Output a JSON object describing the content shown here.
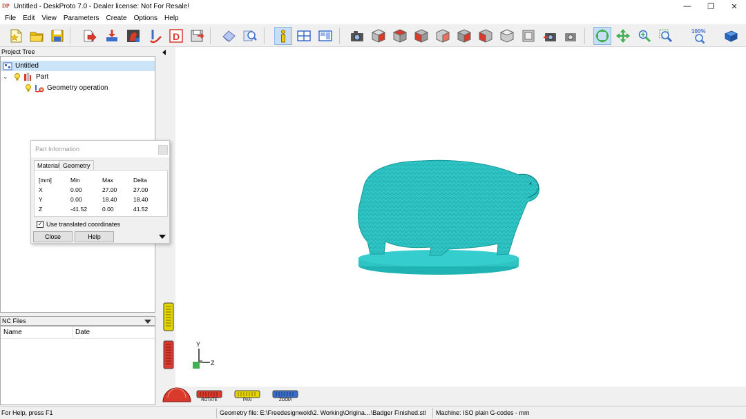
{
  "window": {
    "logo_text": "DP",
    "title": "Untitled - DeskProto 7.0 - Dealer license: Not For Resale!",
    "minimize": "—",
    "restore": "❐",
    "close": "✕"
  },
  "menu": [
    "File",
    "Edit",
    "View",
    "Parameters",
    "Create",
    "Options",
    "Help"
  ],
  "toolbar": {
    "zoom_100_label": "100%"
  },
  "project_tree": {
    "header": "Project Tree",
    "root": "Untitled",
    "part": "Part",
    "operation": "Geometry operation"
  },
  "nc_files": {
    "header": "NC Files",
    "columns": [
      "Name",
      "Date"
    ]
  },
  "part_information": {
    "title": "Part Information",
    "tabs": [
      "Material",
      "Geometry"
    ],
    "headers": [
      "[mm]",
      "Min",
      "Max",
      "Delta"
    ],
    "rows": [
      [
        "X",
        "0.00",
        "27.00",
        "27.00"
      ],
      [
        "Y",
        "0.00",
        "18.40",
        "18.40"
      ],
      [
        "Z",
        "-41.52",
        "0.00",
        "41.52"
      ]
    ],
    "checkbox_label": "Use translated coordinates",
    "checkbox_checked": true,
    "close_button": "Close",
    "help_button": "Help"
  },
  "viewport": {
    "axis_y": "Y",
    "axis_z": "Z",
    "model_color": "#2ec4c4",
    "controls": {
      "rotate": "ROTATE",
      "pan": "PAN",
      "zoom": "ZOOM"
    }
  },
  "status": {
    "help": "For Help, press F1",
    "geometry_file": "Geometry file: E:\\Freedesignwold\\2. Working\\Origina…\\Badger Finished.stl",
    "machine": "Machine: ISO plain G-codes - mm"
  }
}
